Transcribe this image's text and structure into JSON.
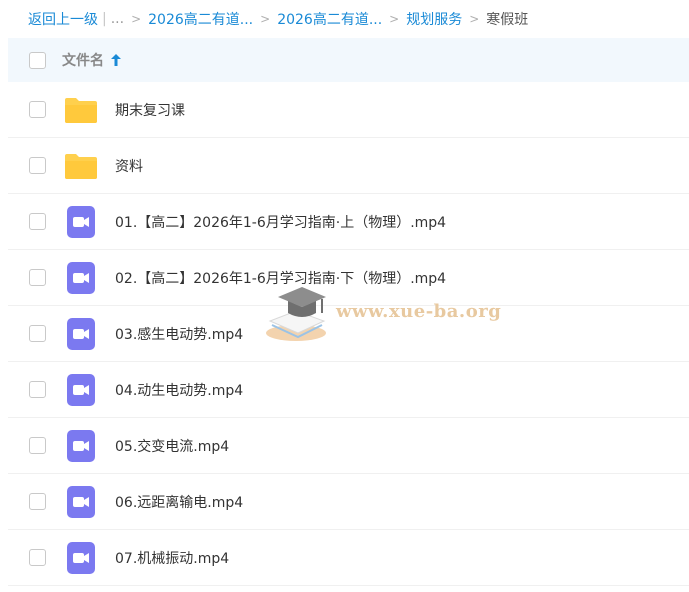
{
  "breadcrumb": {
    "back": "返回上一级",
    "separator": "|",
    "ellipsis": "...",
    "arrow": ">",
    "items": [
      "2026高二有道...",
      "2026高二有道...",
      "规划服务"
    ],
    "current": "寒假班"
  },
  "header": {
    "column_name": "文件名",
    "sort_icon": "arrow-up-icon"
  },
  "files": [
    {
      "name": "期末复习课",
      "type": "folder"
    },
    {
      "name": "资料",
      "type": "folder"
    },
    {
      "name": "01.【高二】2026年1-6月学习指南·上（物理）.mp4",
      "type": "video"
    },
    {
      "name": "02.【高二】2026年1-6月学习指南·下（物理）.mp4",
      "type": "video"
    },
    {
      "name": "03.感生电动势.mp4",
      "type": "video"
    },
    {
      "name": "04.动生电动势.mp4",
      "type": "video"
    },
    {
      "name": "05.交变电流.mp4",
      "type": "video"
    },
    {
      "name": "06.远距离输电.mp4",
      "type": "video"
    },
    {
      "name": "07.机械振动.mp4",
      "type": "video"
    }
  ],
  "watermark": {
    "text": "www.xue-ba.org",
    "icon": "graduation-cap-icon"
  },
  "colors": {
    "link": "#1a8ad6",
    "header_bg": "#f2f8fd",
    "folder": "#ffd04d",
    "video": "#7b79f0"
  }
}
